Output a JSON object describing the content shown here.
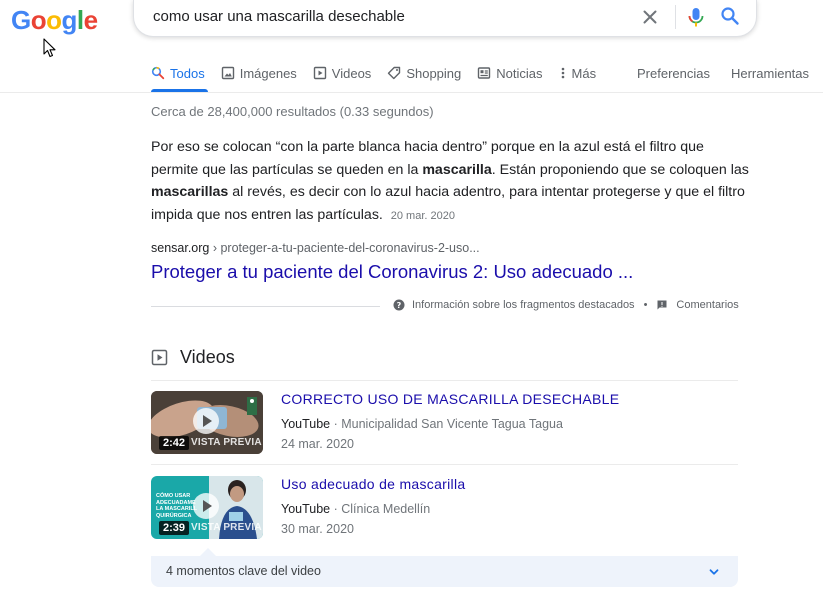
{
  "logo": {
    "letters": [
      "G",
      "o",
      "o",
      "g",
      "l",
      "e"
    ],
    "colors": [
      "#4285F4",
      "#EA4335",
      "#FBBC05",
      "#4285F4",
      "#34A853",
      "#EA4335"
    ]
  },
  "search": {
    "query": "como usar una mascarilla desechable"
  },
  "tabs": [
    {
      "label": "Todos",
      "icon": "search-icon",
      "active": true
    },
    {
      "label": "Imágenes",
      "icon": "image-icon"
    },
    {
      "label": "Videos",
      "icon": "video-icon"
    },
    {
      "label": "Shopping",
      "icon": "tag-icon"
    },
    {
      "label": "Noticias",
      "icon": "news-icon"
    },
    {
      "label": "Más",
      "icon": "more-vertical-icon"
    }
  ],
  "tools": {
    "preferences": "Preferencias",
    "tools": "Herramientas"
  },
  "stats": "Cerca de 28,400,000 resultados (0.33 segundos)",
  "snippet": {
    "part1": "Por eso se colocan “con la parte blanca hacia dentro” porque en la azul está el filtro que permite que las partículas se queden en la ",
    "bold1": "mascarilla",
    "part2": ". Están proponiendo que se coloquen las ",
    "bold2": "mascarillas",
    "part3": " al revés, es decir con lo azul hacia adentro, para intentar protegerse y que el filtro impida que nos entren las partículas.",
    "date": "20 mar. 2020"
  },
  "result": {
    "domain": "sensar.org",
    "path": " › proteger-a-tu-paciente-del-coronavirus-2-uso...",
    "title": "Proteger a tu paciente del Coronavirus 2: Uso adecuado ..."
  },
  "featured_snippet": {
    "info": "Información sobre los fragmentos destacados",
    "separator": "•",
    "feedback": "Comentarios"
  },
  "videos": {
    "heading": "Videos",
    "items": [
      {
        "title": "CORRECTO USO DE MASCARILLA DESECHABLE",
        "source": "YouTube",
        "channel": " · Municipalidad San Vicente Tagua Tagua",
        "date": "24 mar. 2020",
        "duration": "2:42",
        "preview": "VISTA PREVIA"
      },
      {
        "title": "Uso adecuado de mascarilla",
        "source": "YouTube",
        "channel": " · Clínica Medellín",
        "date": "30 mar. 2020",
        "duration": "2:39",
        "preview": "VISTA PREVIA",
        "thumb_text": [
          "CÓMO USAR",
          "ADECUADAME",
          "LA MASCARILL",
          "QUIRÚRGICA"
        ]
      }
    ]
  },
  "key_moments": {
    "label": "4 momentos clave del video"
  },
  "colors": {
    "link": "#1a0dab",
    "accent": "#1a73e8",
    "muted": "#70757a",
    "key_moments_bg": "#eef3fb"
  }
}
